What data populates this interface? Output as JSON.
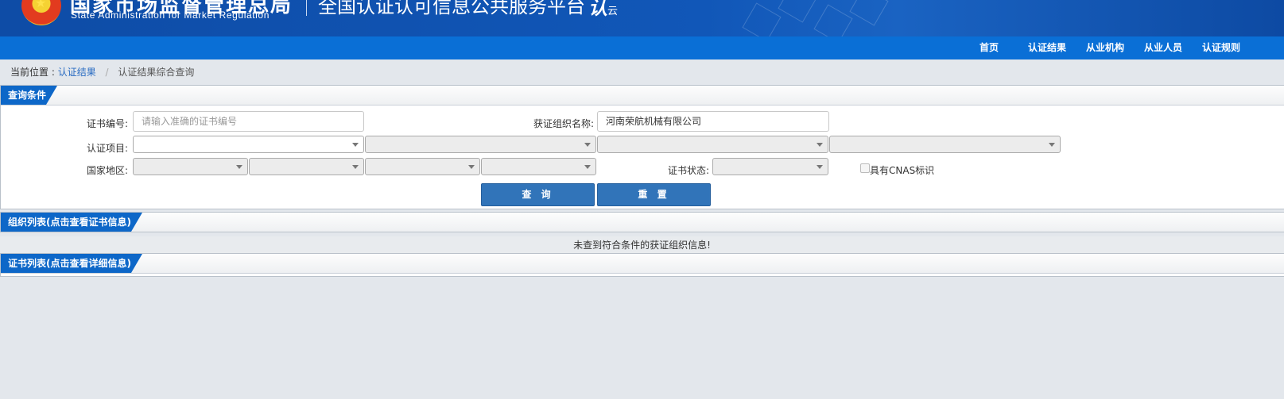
{
  "header": {
    "title_cn": "国家市场监督管理总局",
    "title_en": "State Administration  for  Market Regulation",
    "platform": "全国认证认可信息公共服务平台",
    "logo_main": "认",
    "logo_sub": "云"
  },
  "nav": {
    "items": [
      "首页",
      "认证结果",
      "从业机构",
      "从业人员",
      "认证规则"
    ]
  },
  "breadcrumb": {
    "prefix": "当前位置 :",
    "link": "认证结果",
    "separator": "/",
    "current": "认证结果综合查询"
  },
  "query_panel": {
    "title": "查询条件",
    "cert_no_label": "证书编号:",
    "cert_no_placeholder": "请输入准确的证书编号",
    "org_name_label": "获证组织名称:",
    "org_name_value": "河南荣航机械有限公司",
    "project_label": "认证项目:",
    "region_label": "国家地区:",
    "status_label": "证书状态:",
    "cnas_label": "具有CNAS标识",
    "search_button": "查 询",
    "reset_button": "重 置"
  },
  "org_panel": {
    "title": "组织列表(点击查看证书信息)",
    "empty_message": "未查到符合条件的获证组织信息!"
  },
  "cert_panel": {
    "title": "证书列表(点击查看详细信息)"
  },
  "colors": {
    "header_bg": "#1157b8",
    "nav_bg": "#0a6fd6",
    "tab_bg": "#0d67c8",
    "button_bg": "#3174b9",
    "page_bg": "#e3e7ec"
  }
}
